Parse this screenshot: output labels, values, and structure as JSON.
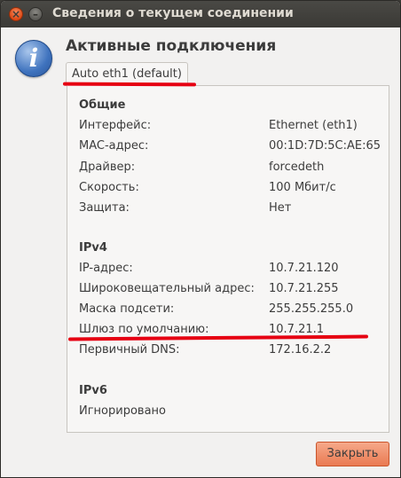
{
  "window": {
    "title": "Сведения о текущем соединении"
  },
  "heading": "Активные подключения",
  "tab": {
    "label": "Auto eth1 (default)"
  },
  "general": {
    "title": "Общие",
    "rows": [
      {
        "label": "Интерфейс:",
        "value": "Ethernet (eth1)"
      },
      {
        "label": "MAC-адрес:",
        "value": "00:1D:7D:5C:AE:65"
      },
      {
        "label": "Драйвер:",
        "value": "forcedeth"
      },
      {
        "label": "Скорость:",
        "value": "100 Мбит/с"
      },
      {
        "label": "Защита:",
        "value": "Нет"
      }
    ]
  },
  "ipv4": {
    "title": "IPv4",
    "rows": [
      {
        "label": "IP-адрес:",
        "value": "10.7.21.120"
      },
      {
        "label": "Широковещательный адрес:",
        "value": "10.7.21.255"
      },
      {
        "label": "Маска подсети:",
        "value": "255.255.255.0"
      },
      {
        "label": "Шлюз по умолчанию:",
        "value": "10.7.21.1"
      },
      {
        "label": "Первичный DNS:",
        "value": "172.16.2.2"
      }
    ]
  },
  "ipv6": {
    "title": "IPv6",
    "status": "Игнорировано"
  },
  "buttons": {
    "close_label": "Закрыть"
  },
  "colors": {
    "accent": "#e95420",
    "annotation": "#e60012",
    "titlebar": "#3c3b37"
  }
}
